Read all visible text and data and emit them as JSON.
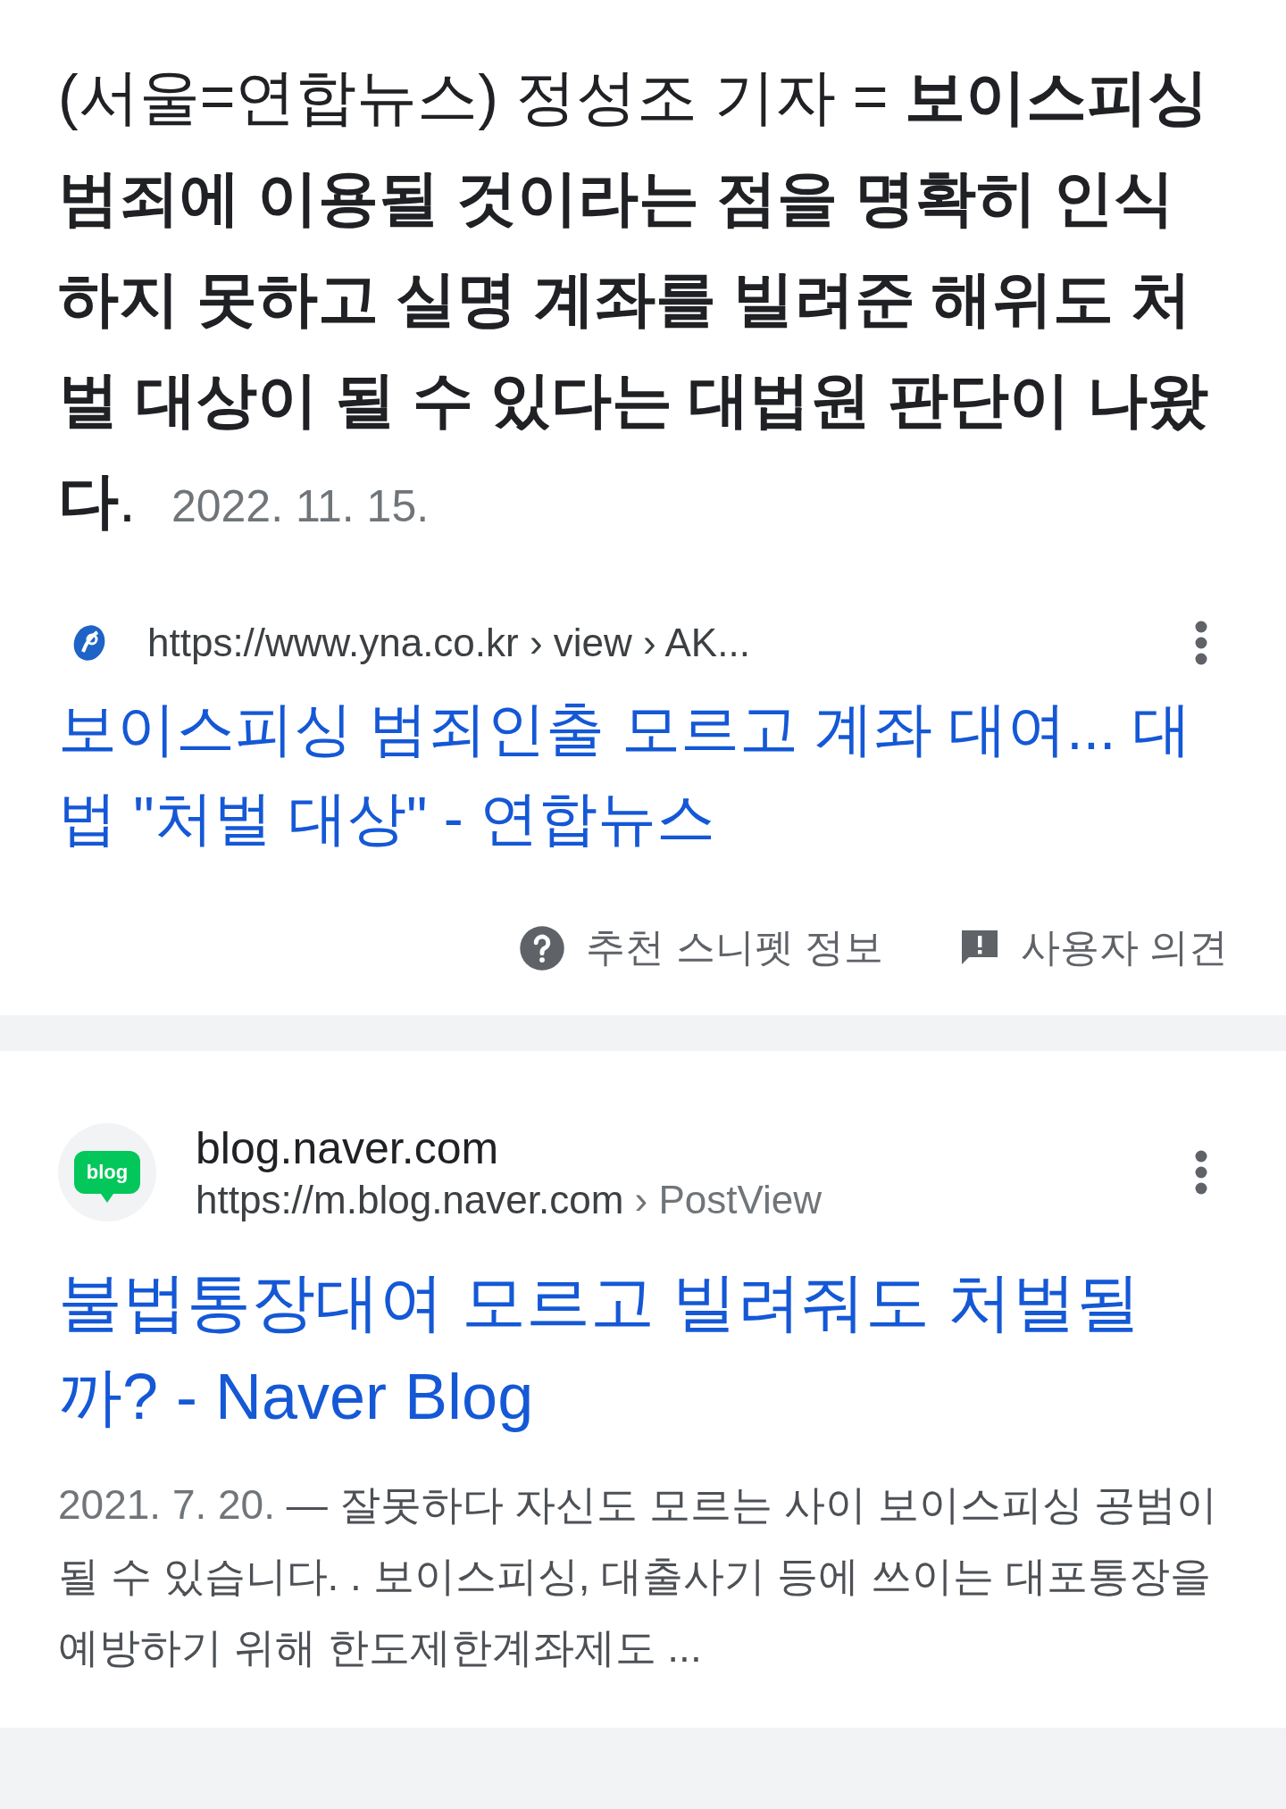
{
  "featured_snippet": {
    "text": "(서울=연합뉴스) 정성조 기자 = **보이스피싱 범죄에 이용될 것이라는 점을 명확히 인식하지 못하고 실명 계좌를 빌려준 해위도 처벌 대상이 될 수 있다는 대법원 판단이 나왔다**.",
    "date": "2022. 11. 15.",
    "source_url": "https://www.yna.co.kr › view › AK...",
    "title": "보이스피싱 범죄인출 모르고 계좌 대여... 대법 \"처벌 대상\" - 연합뉴스",
    "footer_links": [
      {
        "kind": "help",
        "label": "추천 스니펫 정보"
      },
      {
        "kind": "feedback",
        "label": "사용자 의견"
      }
    ]
  },
  "results": [
    {
      "site_icon_text": "blog",
      "site_name": "blog.naver.com",
      "url": "https://m.blog.naver.com",
      "url_path": "› PostView",
      "title": "불법통장대여 모르고 빌려줘도 처벌될까? - Naver Blog",
      "date": "2021. 7. 20.",
      "snippet": "— 잘못하다 자신도 모르는 사이 보이스피싱 공범이 될 수 있습니다. . 보이스피싱, 대출사기 등에 쓰이는 대포통장을 예방하기 위해 한도제한계좌제도 ..."
    }
  ]
}
